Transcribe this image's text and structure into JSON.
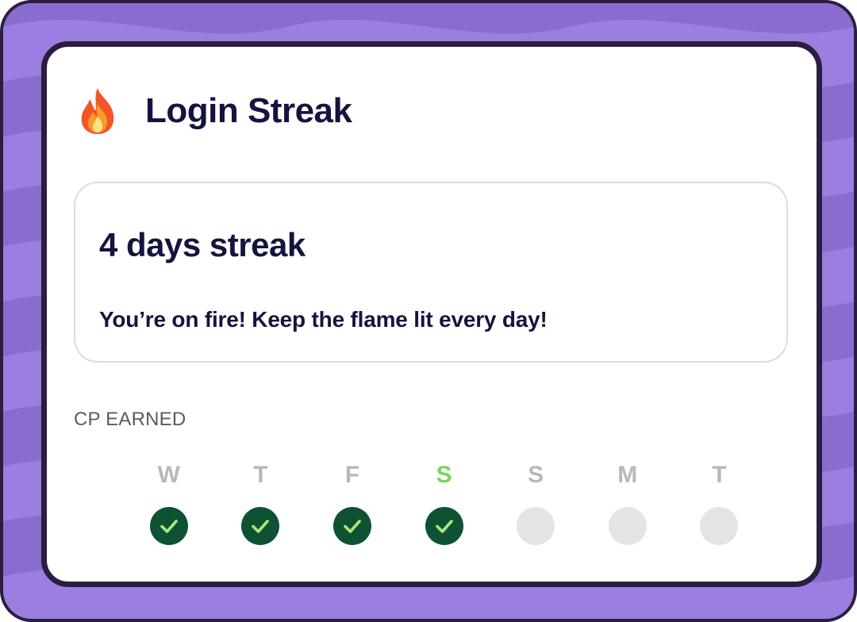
{
  "card": {
    "title": "Login Streak",
    "icon": "fire-icon"
  },
  "streak": {
    "count_text": "4 days streak",
    "message": "You’re on fire! Keep the flame lit every day!"
  },
  "cp": {
    "label": "CP EARNED"
  },
  "days": [
    {
      "letter": "W",
      "done": true,
      "current": false
    },
    {
      "letter": "T",
      "done": true,
      "current": false
    },
    {
      "letter": "F",
      "done": true,
      "current": false
    },
    {
      "letter": "S",
      "done": true,
      "current": true
    },
    {
      "letter": "S",
      "done": false,
      "current": false
    },
    {
      "letter": "M",
      "done": false,
      "current": false
    },
    {
      "letter": "T",
      "done": false,
      "current": false
    }
  ],
  "colors": {
    "frame_purple": "#8a6ccf",
    "frame_border": "#2b1d3f",
    "title_navy": "#14143f",
    "done_green": "#0e5233",
    "check_green": "#a8ea7a",
    "current_day_green": "#7cd458",
    "inactive_gray": "#e4e4e4"
  }
}
